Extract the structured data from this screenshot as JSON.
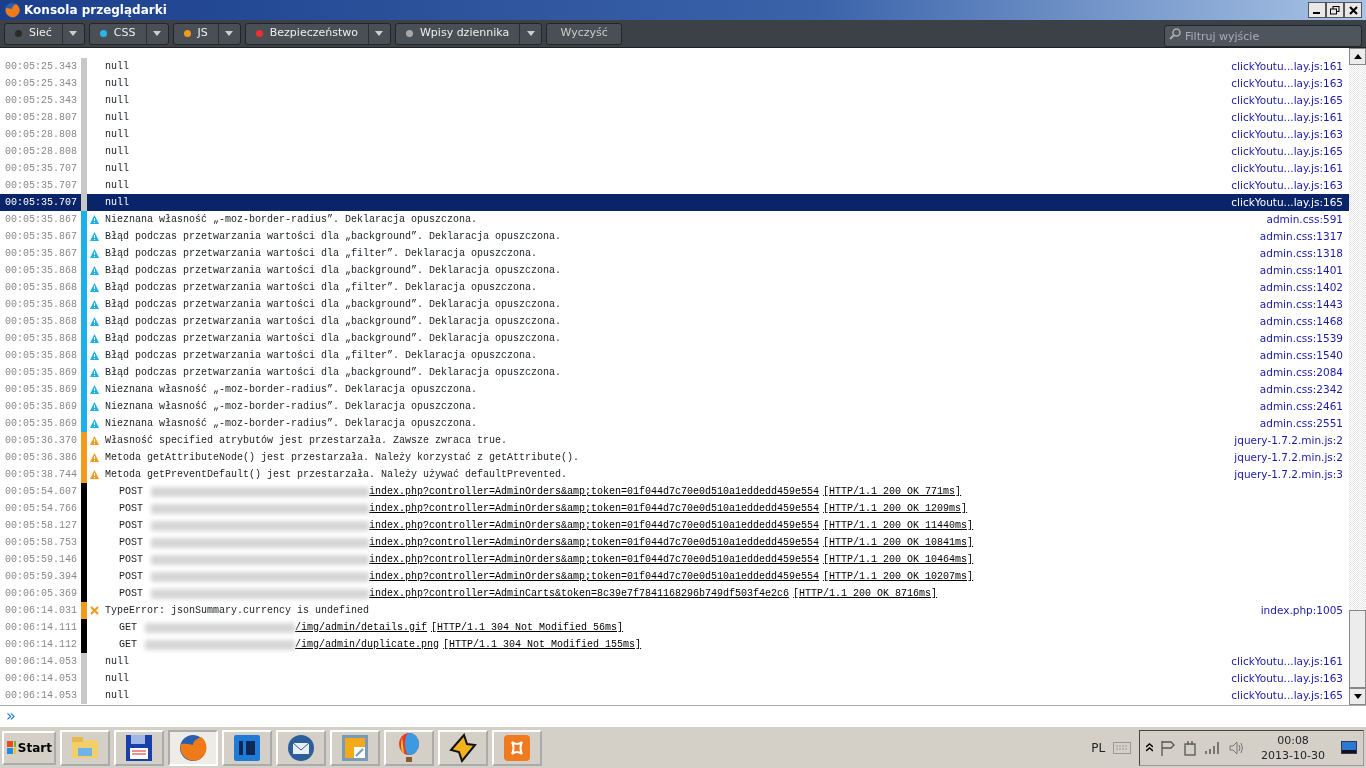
{
  "window": {
    "title": "Konsola przeglądarki"
  },
  "filters": [
    {
      "label": "Sieć",
      "color": "#2b2b2b"
    },
    {
      "label": "CSS",
      "color": "#26b6ec"
    },
    {
      "label": "JS",
      "color": "#f49a1a"
    },
    {
      "label": "Bezpieczeństwo",
      "color": "#ee3030"
    },
    {
      "label": "Wpisy dziennika",
      "color": "#a8a8a8"
    }
  ],
  "clear_button": "Wyczyść",
  "search": {
    "placeholder": "Filtruj wyjście"
  },
  "rows": [
    {
      "time": "00:05:25.343",
      "kind": "log",
      "text": "null",
      "source": "clickYoutu...lay.js:161",
      "selected": false
    },
    {
      "time": "00:05:25.343",
      "kind": "log",
      "text": "null",
      "source": "clickYoutu...lay.js:163",
      "selected": false
    },
    {
      "time": "00:05:25.343",
      "kind": "log",
      "text": "null",
      "source": "clickYoutu...lay.js:165",
      "selected": false
    },
    {
      "time": "00:05:28.807",
      "kind": "log",
      "text": "null",
      "source": "clickYoutu...lay.js:161",
      "selected": false
    },
    {
      "time": "00:05:28.808",
      "kind": "log",
      "text": "null",
      "source": "clickYoutu...lay.js:163",
      "selected": false
    },
    {
      "time": "00:05:28.808",
      "kind": "log",
      "text": "null",
      "source": "clickYoutu...lay.js:165",
      "selected": false
    },
    {
      "time": "00:05:35.707",
      "kind": "log",
      "text": "null",
      "source": "clickYoutu...lay.js:161",
      "selected": false
    },
    {
      "time": "00:05:35.707",
      "kind": "log",
      "text": "null",
      "source": "clickYoutu...lay.js:163",
      "selected": false
    },
    {
      "time": "00:05:35.707",
      "kind": "log",
      "text": "null",
      "source": "clickYoutu...lay.js:165",
      "selected": true
    },
    {
      "time": "00:05:35.867",
      "kind": "css",
      "text": "Nieznana własność „-moz-border-radius”.  Deklaracja opuszczona.",
      "source": "admin.css:591",
      "selected": false
    },
    {
      "time": "00:05:35.867",
      "kind": "css",
      "text": "Błąd podczas przetwarzania wartości dla „background”.  Deklaracja opuszczona.",
      "source": "admin.css:1317",
      "selected": false
    },
    {
      "time": "00:05:35.867",
      "kind": "css",
      "text": "Błąd podczas przetwarzania wartości dla „filter”.  Deklaracja opuszczona.",
      "source": "admin.css:1318",
      "selected": false
    },
    {
      "time": "00:05:35.868",
      "kind": "css",
      "text": "Błąd podczas przetwarzania wartości dla „background”.  Deklaracja opuszczona.",
      "source": "admin.css:1401",
      "selected": false
    },
    {
      "time": "00:05:35.868",
      "kind": "css",
      "text": "Błąd podczas przetwarzania wartości dla „filter”.  Deklaracja opuszczona.",
      "source": "admin.css:1402",
      "selected": false
    },
    {
      "time": "00:05:35.868",
      "kind": "css",
      "text": "Błąd podczas przetwarzania wartości dla „background”.  Deklaracja opuszczona.",
      "source": "admin.css:1443",
      "selected": false
    },
    {
      "time": "00:05:35.868",
      "kind": "css",
      "text": "Błąd podczas przetwarzania wartości dla „background”.  Deklaracja opuszczona.",
      "source": "admin.css:1468",
      "selected": false
    },
    {
      "time": "00:05:35.868",
      "kind": "css",
      "text": "Błąd podczas przetwarzania wartości dla „background”.  Deklaracja opuszczona.",
      "source": "admin.css:1539",
      "selected": false
    },
    {
      "time": "00:05:35.868",
      "kind": "css",
      "text": "Błąd podczas przetwarzania wartości dla „filter”.  Deklaracja opuszczona.",
      "source": "admin.css:1540",
      "selected": false
    },
    {
      "time": "00:05:35.869",
      "kind": "css",
      "text": "Błąd podczas przetwarzania wartości dla „background”.  Deklaracja opuszczona.",
      "source": "admin.css:2084",
      "selected": false
    },
    {
      "time": "00:05:35.869",
      "kind": "css",
      "text": "Nieznana własność „-moz-border-radius”.  Deklaracja opuszczona.",
      "source": "admin.css:2342",
      "selected": false
    },
    {
      "time": "00:05:35.869",
      "kind": "css",
      "text": "Nieznana własność „-moz-border-radius”.  Deklaracja opuszczona.",
      "source": "admin.css:2461",
      "selected": false
    },
    {
      "time": "00:05:35.869",
      "kind": "css",
      "text": "Nieznana własność „-moz-border-radius”.  Deklaracja opuszczona.",
      "source": "admin.css:2551",
      "selected": false
    },
    {
      "time": "00:05:36.370",
      "kind": "js",
      "text": "Własność specified atrybutów jest przestarzała. Zawsze zwraca true.",
      "source": "jquery-1.7.2.min.js:2",
      "selected": false
    },
    {
      "time": "00:05:36.386",
      "kind": "js",
      "text": "Metoda getAttributeNode() jest przestarzała. Należy korzystać z getAttribute().",
      "source": "jquery-1.7.2.min.js:2",
      "selected": false
    },
    {
      "time": "00:05:38.744",
      "kind": "js",
      "text": "Metoda getPreventDefault() jest przestarzała.  Należy używać defaultPrevented.",
      "source": "jquery-1.7.2.min.js:3",
      "selected": false
    },
    {
      "time": "00:05:54.607",
      "kind": "net",
      "method": "POST",
      "path": "index.php?controller=AdminOrders&amp;token=01f044d7c70e0d510a1eddedd459e554",
      "status": "[HTTP/1.1 200 OK 771ms]",
      "selected": false
    },
    {
      "time": "00:05:54.766",
      "kind": "net",
      "method": "POST",
      "path": "index.php?controller=AdminOrders&amp;token=01f044d7c70e0d510a1eddedd459e554",
      "status": "[HTTP/1.1 200 OK 1209ms]",
      "selected": false
    },
    {
      "time": "00:05:58.127",
      "kind": "net",
      "method": "POST",
      "path": "index.php?controller=AdminOrders&amp;token=01f044d7c70e0d510a1eddedd459e554",
      "status": "[HTTP/1.1 200 OK 11440ms]",
      "selected": false
    },
    {
      "time": "00:05:58.753",
      "kind": "net",
      "method": "POST",
      "path": "index.php?controller=AdminOrders&amp;token=01f044d7c70e0d510a1eddedd459e554",
      "status": "[HTTP/1.1 200 OK 10841ms]",
      "selected": false
    },
    {
      "time": "00:05:59.146",
      "kind": "net",
      "method": "POST",
      "path": "index.php?controller=AdminOrders&amp;token=01f044d7c70e0d510a1eddedd459e554",
      "status": "[HTTP/1.1 200 OK 10464ms]",
      "selected": false
    },
    {
      "time": "00:05:59.394",
      "kind": "net",
      "method": "POST",
      "path": "index.php?controller=AdminOrders&amp;token=01f044d7c70e0d510a1eddedd459e554",
      "status": "[HTTP/1.1 200 OK 10207ms]",
      "selected": false
    },
    {
      "time": "00:06:05.369",
      "kind": "net",
      "method": "POST",
      "path": "index.php?controller=AdminCarts&token=8c39e7f7841168296b749df503f4e2c6",
      "status": "[HTTP/1.1 200 OK 8716ms]",
      "selected": false
    },
    {
      "time": "00:06:14.031",
      "kind": "error",
      "text": "TypeError: jsonSummary.currency is undefined",
      "source": "index.php:1005",
      "selected": false
    },
    {
      "time": "00:06:14.111",
      "kind": "net",
      "method": "GET",
      "path": "/img/admin/details.gif",
      "status": "[HTTP/1.1 304 Not Modified 56ms]",
      "selected": false
    },
    {
      "time": "00:06:14.112",
      "kind": "net",
      "method": "GET",
      "path": "/img/admin/duplicate.png",
      "status": "[HTTP/1.1 304 Not Modified 155ms]",
      "selected": false
    },
    {
      "time": "00:06:14.053",
      "kind": "log",
      "text": "null",
      "source": "clickYoutu...lay.js:161",
      "selected": false
    },
    {
      "time": "00:06:14.053",
      "kind": "log",
      "text": "null",
      "source": "clickYoutu...lay.js:163",
      "selected": false
    },
    {
      "time": "00:06:14.053",
      "kind": "log",
      "text": "null",
      "source": "clickYoutu...lay.js:165",
      "selected": false
    }
  ],
  "input": {
    "prompt": "»"
  },
  "taskbar": {
    "start": "Start",
    "apps": [
      {
        "kind": "folder",
        "selected": false
      },
      {
        "kind": "floppy",
        "selected": false
      },
      {
        "kind": "firefox",
        "selected": true
      },
      {
        "kind": "ps",
        "selected": false
      },
      {
        "kind": "mail",
        "selected": false
      },
      {
        "kind": "viewer",
        "selected": false
      },
      {
        "kind": "balloon",
        "selected": false
      },
      {
        "kind": "bolt",
        "selected": false
      },
      {
        "kind": "xampp",
        "selected": false
      }
    ],
    "language": "PL",
    "time": "00:08",
    "date": "2013-10-30"
  }
}
